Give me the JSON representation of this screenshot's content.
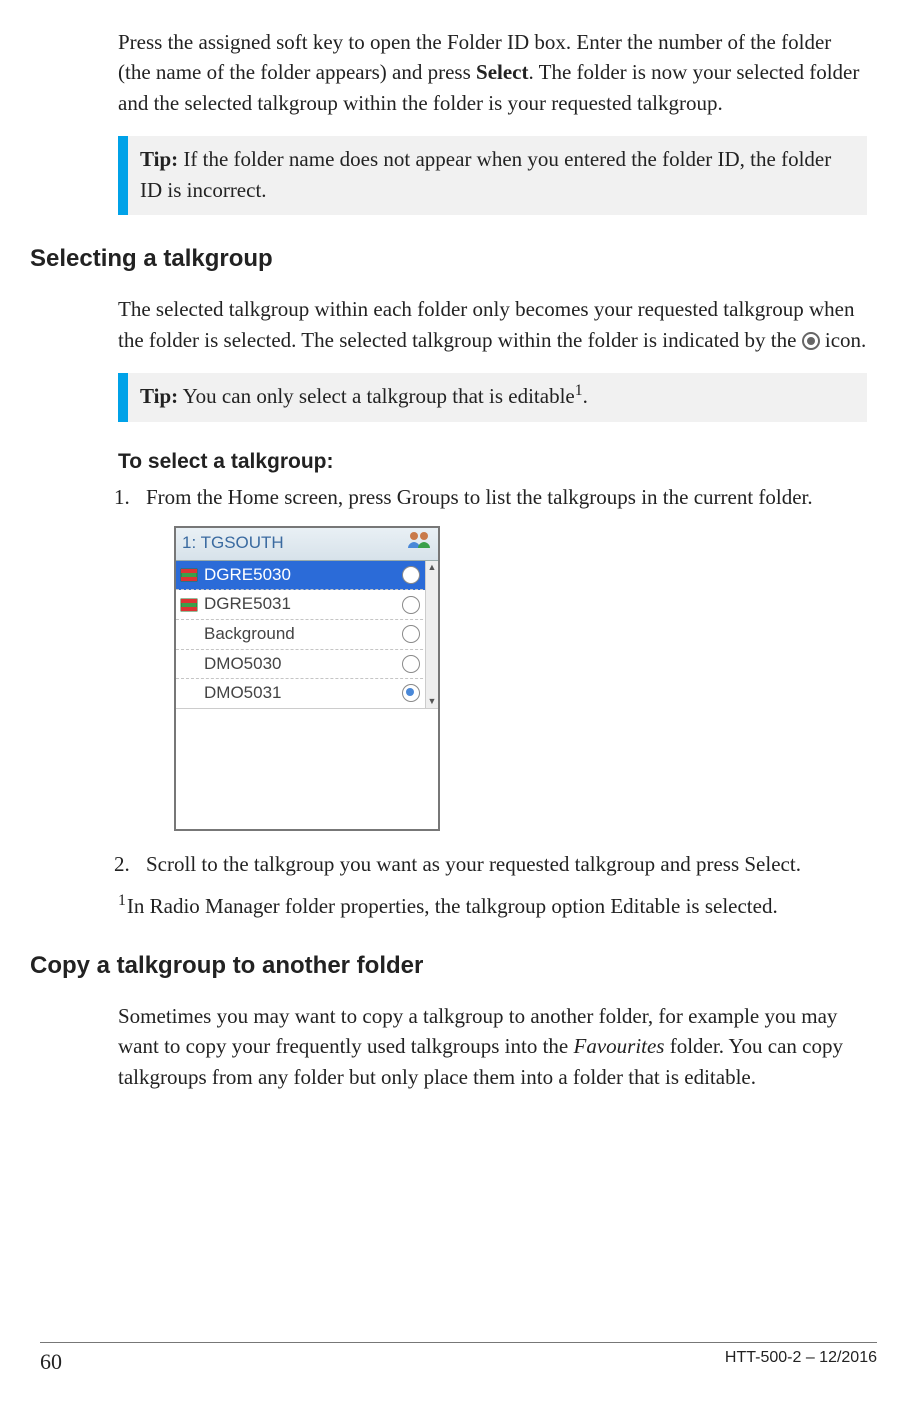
{
  "intro": {
    "pre": "Press the assigned soft key to open the Folder ID box. Enter the number of the folder (the name of the folder appears) and press ",
    "bold": "Select",
    "post": ". The folder is now your selected folder and the selected talkgroup within the folder is your requested talkgroup."
  },
  "tip1": {
    "label": "Tip:",
    "text": "  If the folder name does not appear when you entered the folder ID, the folder ID is incorrect."
  },
  "section_select": {
    "heading": "Selecting a talkgroup",
    "para_pre": "The selected talkgroup within each folder only becomes your requested talkgroup when the folder is selected. The selected talkgroup within the folder is indicated by the ",
    "para_post": " icon."
  },
  "tip2": {
    "label": "Tip:",
    "text_pre": "  You can only select a talkgroup that is editable",
    "sup": "1",
    "text_post": "."
  },
  "procedure": {
    "heading": "To select a talkgroup:",
    "step1": {
      "num": "1.",
      "pre": "From the ",
      "b1": "Home",
      "mid": " screen, press ",
      "b2": "Groups",
      "post": " to list the talkgroups in the current folder."
    },
    "step2": {
      "num": "2.",
      "pre": "Scroll to the talkgroup you want as your requested talkgroup and press ",
      "b1": "Select",
      "post": "."
    }
  },
  "device": {
    "title": "1: TGSOUTH",
    "rows": [
      {
        "label": "DGRE5030",
        "flag": true,
        "selected": true,
        "radio": "off"
      },
      {
        "label": "DGRE5031",
        "flag": true,
        "selected": false,
        "radio": "off"
      },
      {
        "label": "Background",
        "flag": false,
        "selected": false,
        "radio": "off"
      },
      {
        "label": "DMO5030",
        "flag": false,
        "selected": false,
        "radio": "off"
      },
      {
        "label": "DMO5031",
        "flag": false,
        "selected": false,
        "radio": "on"
      }
    ]
  },
  "footnote": {
    "sup": "1",
    "pre": "In Radio Manager folder properties, the talkgroup option ",
    "bold": "Editable",
    "post": " is selected."
  },
  "section_copy": {
    "heading": "Copy a talkgroup to another folder",
    "pre": "Sometimes you may want to copy a talkgroup to another folder, for example you may want to copy your frequently used talkgroups into the ",
    "italic": "Favourites",
    "post": " folder. You can copy talkgroups from any folder but only place them into a folder that is editable."
  },
  "footer": {
    "page": "60",
    "doc": "HTT-500-2 – 12/2016"
  }
}
